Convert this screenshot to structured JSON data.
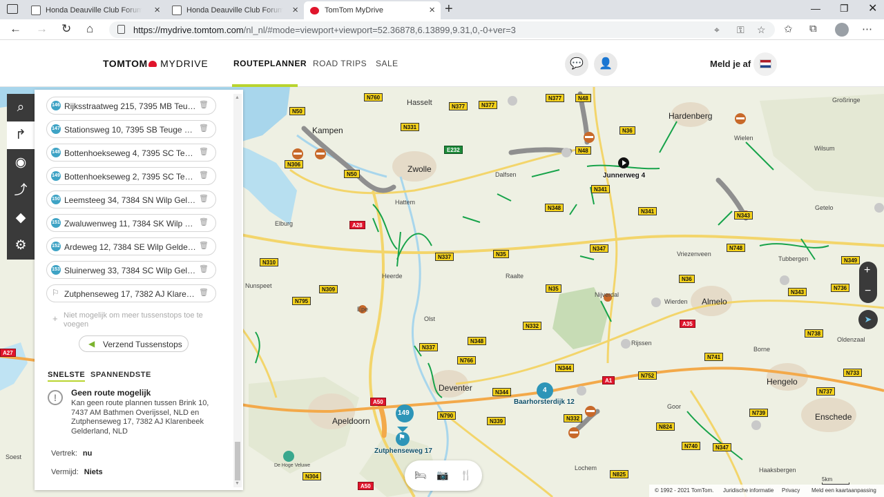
{
  "browser": {
    "tabs": [
      {
        "title": "Honda Deauville Club Forum - F"
      },
      {
        "title": "Honda Deauville Club Forum - Pl"
      },
      {
        "title": "TomTom MyDrive"
      }
    ],
    "url_host": "https://mydrive.tomtom.com",
    "url_rest": "/nl_nl/#mode=viewport+viewport=52.36878,6.13899,9.31,0,-0+ver=3"
  },
  "site": {
    "logo_brand": "TOMTOM",
    "logo_product": "MYDRIVE",
    "nav": [
      {
        "label": "ROUTEPLANNER"
      },
      {
        "label": "ROAD TRIPS"
      },
      {
        "label": "SALE"
      }
    ],
    "logout_label": "Meld je af"
  },
  "panel": {
    "stops": [
      {
        "badge": "146",
        "address": "Rijksstraatweg 215, 7395 MB Teuge Gelderland, NLD"
      },
      {
        "badge": "147",
        "address": "Stationsweg 10, 7395 SB Teuge Gelderland, NLD"
      },
      {
        "badge": "148",
        "address": "Bottenhoekseweg 4, 7395 SC Teuge Gelderland, NLD"
      },
      {
        "badge": "149",
        "address": "Bottenhoekseweg 2, 7395 SC Teuge Gelderland, NLD"
      },
      {
        "badge": "150",
        "address": "Leemsteeg 34, 7384 SN Wilp Gelderland, NLD"
      },
      {
        "badge": "151",
        "address": "Zwaluwenweg 11, 7384 SK Wilp Gelderland, NLD"
      },
      {
        "badge": "152",
        "address": "Ardeweg 12, 7384 SE Wilp Gelderland, NLD"
      },
      {
        "badge": "153",
        "address": "Sluinerweg 33, 7384 SC Wilp Gelderland, NLD"
      },
      {
        "badge": "",
        "address": "Zutphenseweg 17, 7382 AJ Klarenbeek Gelderland, NLD"
      }
    ],
    "add_stop_text": "Niet mogelijk om meer tussenstops toe te voegen",
    "send_button": "Verzend Tussenstops",
    "route_tabs": [
      {
        "label": "SNELSTE"
      },
      {
        "label": "SPANNENDSTE"
      }
    ],
    "warning_title": "Geen route mogelijk",
    "warning_text": "Kan geen route plannen tussen Brink 10, 7437 AM Bathmen Overijssel, NLD en Zutphenseweg 17, 7382 AJ Klarenbeek Gelderland, NLD",
    "depart_label": "Vertrek:",
    "depart_value": "nu",
    "avoid_label": "Vermijd:",
    "avoid_value": "Niets"
  },
  "map": {
    "towns": [
      {
        "name": "Hasselt"
      },
      {
        "name": "Hardenberg"
      },
      {
        "name": "Großringe"
      },
      {
        "name": "Kampen"
      },
      {
        "name": "Zwolle"
      },
      {
        "name": "Dalfsen"
      },
      {
        "name": "Wielen"
      },
      {
        "name": "Wilsum"
      },
      {
        "name": "Hattem"
      },
      {
        "name": "Getelo"
      },
      {
        "name": "Elburg"
      },
      {
        "name": "Vriezenveen"
      },
      {
        "name": "Tubbergen"
      },
      {
        "name": "Heerde"
      },
      {
        "name": "Raalte"
      },
      {
        "name": "Nunspeet"
      },
      {
        "name": "Nijverdal"
      },
      {
        "name": "Wierden"
      },
      {
        "name": "Almelo"
      },
      {
        "name": "Epe"
      },
      {
        "name": "Olst"
      },
      {
        "name": "Rijssen"
      },
      {
        "name": "Oldenzaal"
      },
      {
        "name": "Borne"
      },
      {
        "name": "Deventer"
      },
      {
        "name": "Hengelo"
      },
      {
        "name": "Apeldoorn"
      },
      {
        "name": "Goor"
      },
      {
        "name": "Enschede"
      },
      {
        "name": "Soest"
      },
      {
        "name": "Lochem"
      },
      {
        "name": "Haaksbergen"
      },
      {
        "name": "De Hoge Veluwe"
      }
    ],
    "waypoint_labels": [
      {
        "name": "Junnerweg 4"
      },
      {
        "name": "Baarhorsterdijk 12"
      },
      {
        "name": "Zutphenseweg 17"
      }
    ],
    "cluster_badges": [
      "149",
      "4"
    ],
    "roads": [
      "N760",
      "N377",
      "N377",
      "N377",
      "N48",
      "N50",
      "N331",
      "N36",
      "E232",
      "N48",
      "N306",
      "N50",
      "N341",
      "N348",
      "N341",
      "A28",
      "N343",
      "N347",
      "N748",
      "N337",
      "N35",
      "N310",
      "N349",
      "N36",
      "N309",
      "N35",
      "N343",
      "N736",
      "N795",
      "A35",
      "N332",
      "N348",
      "N738",
      "A27",
      "N337",
      "N766",
      "N741",
      "N344",
      "N752",
      "A1",
      "N733",
      "N344",
      "A50",
      "N737",
      "N790",
      "N339",
      "N332",
      "N739",
      "N824",
      "N740",
      "N347",
      "N825",
      "N304",
      "A50"
    ],
    "footer": {
      "copyright": "© 1992 - 2021 TomTom.",
      "legal": "Juridische informatie",
      "privacy": "Privacy",
      "report": "Meld een kaartaanpassing"
    },
    "scale": "5km"
  }
}
